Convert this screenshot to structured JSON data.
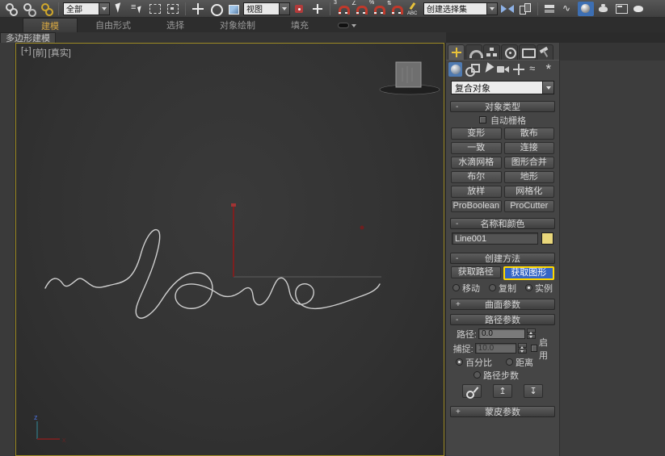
{
  "toolbar": {
    "items": [
      {
        "name": "select-and-link-icon",
        "kind": "chain"
      },
      {
        "name": "unlink-selection-icon",
        "kind": "chain-broken"
      },
      {
        "name": "bind-to-space-warp-icon",
        "kind": "chain-yellow"
      },
      {
        "kind": "sep"
      },
      {
        "name": "selection-filter-dropdown",
        "kind": "dropdown",
        "label": "全部"
      },
      {
        "name": "select-object-icon",
        "kind": "cursor"
      },
      {
        "name": "select-by-name-icon",
        "kind": "list"
      },
      {
        "name": "rect-selection-region-icon",
        "kind": "dashbox"
      },
      {
        "name": "window-crossing-icon",
        "kind": "dashbox2"
      },
      {
        "kind": "sep"
      },
      {
        "name": "select-and-move-icon",
        "kind": "move"
      },
      {
        "name": "select-and-rotate-icon",
        "kind": "rotate"
      },
      {
        "name": "select-and-scale-icon",
        "kind": "scale"
      },
      {
        "name": "reference-coordinate-dropdown",
        "kind": "dropdown",
        "label": "视图"
      },
      {
        "name": "use-pivot-point-center-icon",
        "kind": "pivot"
      },
      {
        "name": "select-and-manipulate-icon",
        "kind": "manip"
      },
      {
        "kind": "sep"
      },
      {
        "name": "snap-toggle-3d-icon",
        "kind": "magnet",
        "glyph": "3"
      },
      {
        "name": "angle-snap-toggle-icon",
        "kind": "magnet",
        "glyph": "∠"
      },
      {
        "name": "percent-snap-toggle-icon",
        "kind": "magnet",
        "glyph": "%"
      },
      {
        "name": "spinner-snap-toggle-icon",
        "kind": "magnet",
        "glyph": "⇅"
      },
      {
        "name": "edit-named-selection-sets-icon",
        "kind": "abc"
      },
      {
        "name": "named-selection-sets-dropdown",
        "kind": "dropdown-wide",
        "label": "创建选择集"
      },
      {
        "name": "mirror-icon",
        "kind": "mirror"
      },
      {
        "name": "align-icon",
        "kind": "align"
      },
      {
        "kind": "sep"
      },
      {
        "name": "manage-layers-icon",
        "kind": "layers"
      },
      {
        "name": "graph-editors-icon",
        "kind": "graph"
      },
      {
        "name": "material-editor-icon",
        "kind": "mated",
        "active": true
      },
      {
        "name": "render-setup-icon",
        "kind": "rsetup"
      },
      {
        "name": "rendered-frame-window-icon",
        "kind": "rframe"
      },
      {
        "name": "render-production-icon",
        "kind": "render"
      }
    ]
  },
  "ribbon": {
    "tabs": [
      {
        "label": "建模",
        "active": true
      },
      {
        "label": "自由形式",
        "active": false
      },
      {
        "label": "选择",
        "active": false
      },
      {
        "label": "对象绘制",
        "active": false
      },
      {
        "label": "填充",
        "active": false
      }
    ],
    "subtab": "多边形建模"
  },
  "viewport": {
    "label_nav": "[+]",
    "label_view": "[前]",
    "label_shading": "[真实]",
    "axis_z_label": "z",
    "spline_color": "#cfcfcf",
    "path_line_color": "#7d1f1f"
  },
  "command_panel": {
    "tab_icons": [
      {
        "name": "create-tab-icon",
        "cls": "cpt-create",
        "active": true
      },
      {
        "name": "modify-tab-icon",
        "cls": "cpt-modify"
      },
      {
        "name": "hierarchy-tab-icon",
        "cls": "cpt-hierarchy"
      },
      {
        "name": "motion-tab-icon",
        "cls": "cpt-motion"
      },
      {
        "name": "display-tab-icon",
        "cls": "cpt-display"
      },
      {
        "name": "utilities-tab-icon",
        "cls": "cpt-utilities"
      }
    ],
    "category_icons": [
      {
        "name": "geometry-category-icon",
        "cls": "catg",
        "active": true
      },
      {
        "name": "shapes-category-icon",
        "cls": "cats"
      },
      {
        "name": "lights-category-icon",
        "cls": "catl"
      },
      {
        "name": "cameras-category-icon",
        "cls": "catc"
      },
      {
        "name": "helpers-category-icon",
        "cls": "cath"
      },
      {
        "name": "space-warps-category-icon",
        "cls": "catw"
      },
      {
        "name": "systems-category-icon",
        "cls": "caty"
      }
    ],
    "category_dropdown": "复合对象",
    "rollouts": {
      "object_type": {
        "title": "对象类型",
        "sign": "-",
        "autogrid_label": "自动栅格",
        "autogrid_checked": false,
        "buttons": [
          "变形",
          "散布",
          "一致",
          "连接",
          "水滴网格",
          "图形合并",
          "布尔",
          "地形",
          "放样",
          "网格化",
          "ProBoolean",
          "ProCutter"
        ]
      },
      "name_color": {
        "title": "名称和颜色",
        "sign": "-",
        "name_value": "Line001",
        "object_color": "#e9d77b"
      },
      "creation_method": {
        "title": "创建方法",
        "sign": "-",
        "get_path_label": "获取路径",
        "get_shape_label": "获取图形",
        "get_shape_active": true,
        "highlight_color": "#ffd800",
        "radios": [
          "移动",
          "复制",
          "实例"
        ],
        "selected_radio": "实例"
      },
      "surface_params": {
        "title": "曲面参数",
        "sign": "+"
      },
      "path_params": {
        "title": "路径参数",
        "sign": "-",
        "path_label": "路径:",
        "path_value": "0.0",
        "snap_label": "捕捉:",
        "snap_value": "10.0",
        "enable_label": "启用",
        "enable_checked": false,
        "percent_label": "百分比",
        "distance_label": "距离",
        "steps_label": "路径步数",
        "selected_mode": "百分比",
        "buttons": [
          {
            "name": "pick-shape-icon",
            "cls": "ppb-pick",
            "glyph": ""
          },
          {
            "name": "previous-shape-icon",
            "cls": "",
            "glyph": "↥"
          },
          {
            "name": "next-shape-icon",
            "cls": "",
            "glyph": "↧"
          }
        ]
      },
      "skin_params": {
        "title": "蒙皮参数",
        "sign": "+"
      }
    }
  }
}
